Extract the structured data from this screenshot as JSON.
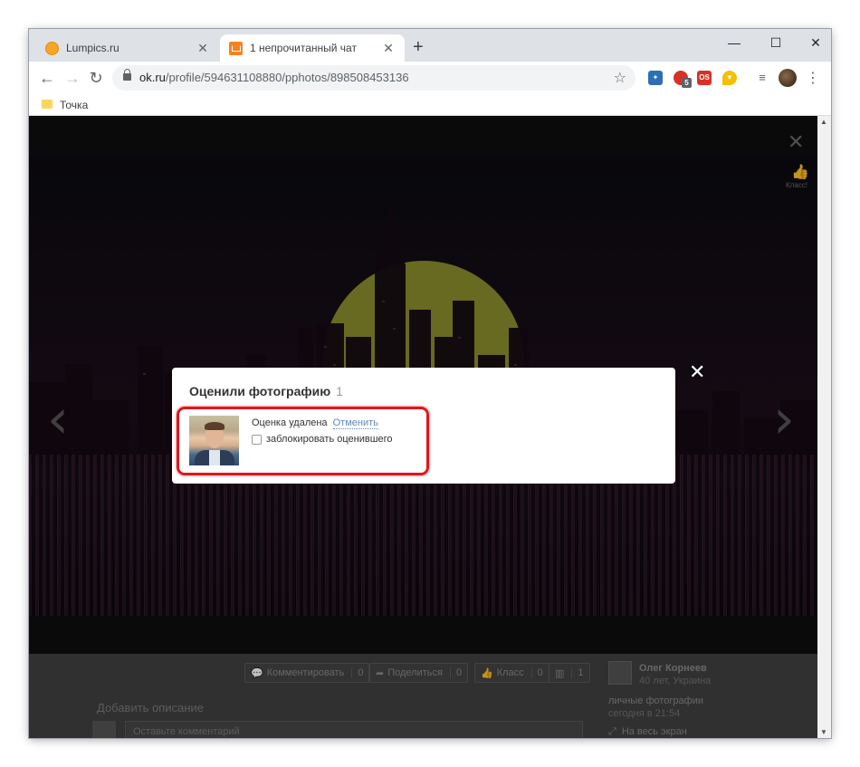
{
  "browser": {
    "tabs": [
      {
        "title": "Lumpics.ru",
        "active": false
      },
      {
        "title": "1 непрочитанный чат",
        "active": true
      }
    ],
    "new_tab_label": "+",
    "url_host": "ok.ru",
    "url_path": "/profile/594631108880/pphotos/898508453136",
    "extension_badge": "5",
    "extension_label": "OS",
    "bookmark": "Точка"
  },
  "viewer": {
    "like_label": "Класс!",
    "actions": [
      {
        "label": "Комментировать",
        "count": "0"
      },
      {
        "label": "Поделиться",
        "count": "0"
      },
      {
        "label": "Класс",
        "count": "0"
      },
      {
        "label": "",
        "count": "1"
      }
    ],
    "add_description": "Добавить описание",
    "comment_placeholder": "Оставьте комментарий",
    "owner_name": "Олег Корнеев",
    "owner_meta": "40 лет, Украина",
    "album": "личные фотографии",
    "uploaded": "сегодня в 21:54",
    "fullscreen": "На весь экран"
  },
  "modal": {
    "title": "Оценили фотографию",
    "count": "1",
    "status_text": "Оценка удалена",
    "undo_label": "Отменить",
    "block_label": "заблокировать оценившего",
    "block_checked": false
  },
  "colors": {
    "highlight": "#e2151d",
    "link": "#5f87b8",
    "ok_orange": "#f58220"
  }
}
